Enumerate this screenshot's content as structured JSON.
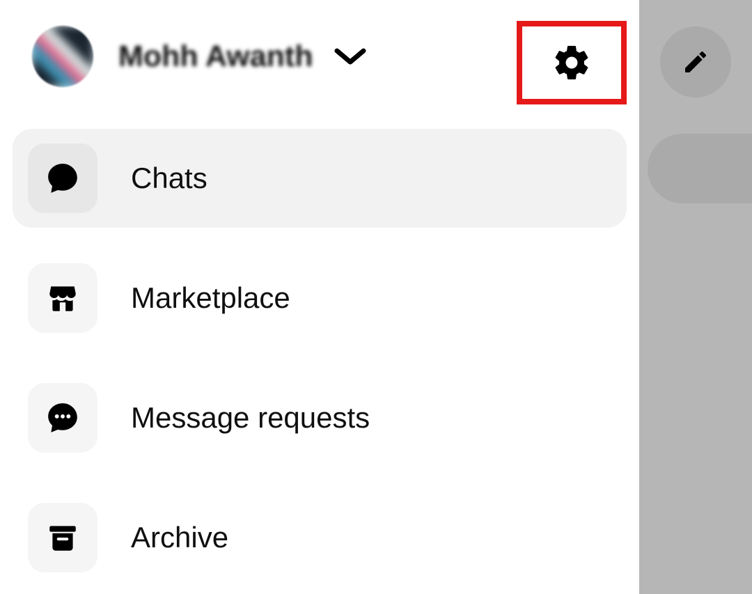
{
  "header": {
    "username": "Mohh Awanth",
    "settings_highlight": "#e61919"
  },
  "menu": {
    "items": [
      {
        "id": "chats",
        "label": "Chats",
        "active": true
      },
      {
        "id": "marketplace",
        "label": "Marketplace",
        "active": false
      },
      {
        "id": "message-requests",
        "label": "Message requests",
        "active": false
      },
      {
        "id": "archive",
        "label": "Archive",
        "active": false
      }
    ]
  }
}
